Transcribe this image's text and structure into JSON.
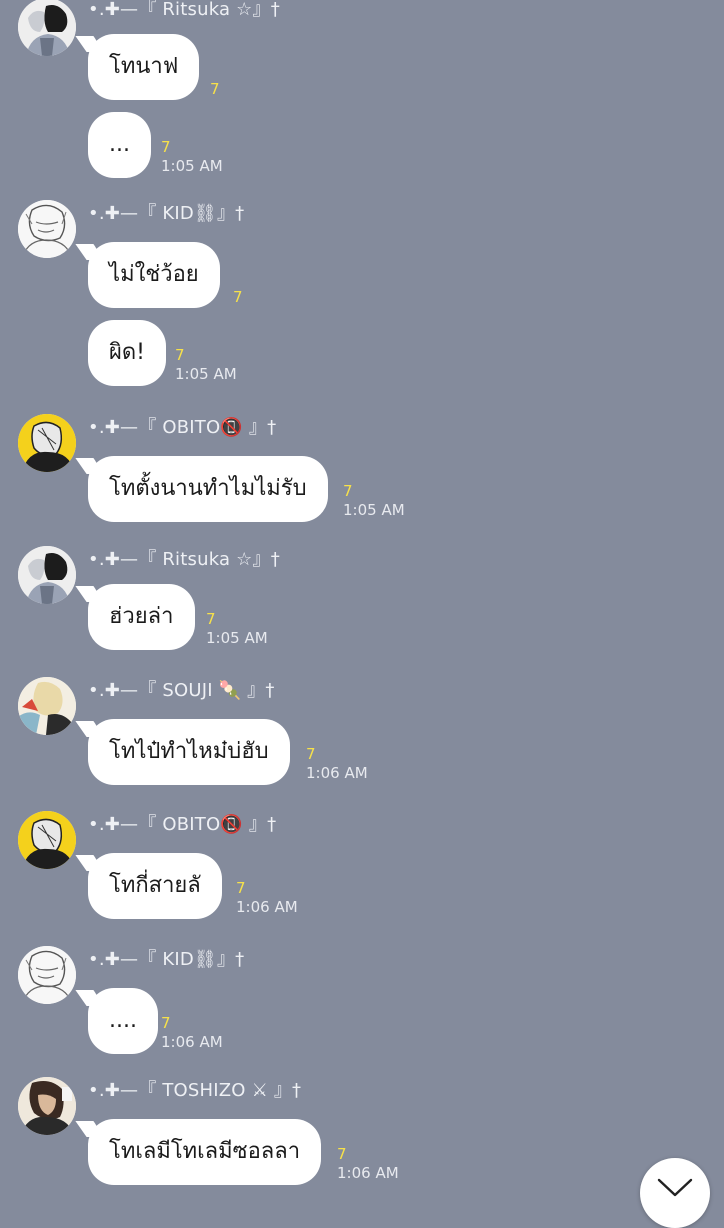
{
  "chat": {
    "messages": [
      {
        "sender": "•.✚—『 Ritsuka ☆』†",
        "avatar": "ritsuka-avatar",
        "bubbles": [
          {
            "text": "โทนาฟ",
            "read": "7",
            "time": ""
          },
          {
            "text": "...",
            "read": "7",
            "time": "1:05 AM"
          }
        ]
      },
      {
        "sender": "•.✚—『 KID⛓』†",
        "avatar": "kid-avatar",
        "bubbles": [
          {
            "text": "ไม่ใช่ว้อย",
            "read": "7",
            "time": ""
          },
          {
            "text": "ผิด!",
            "read": "7",
            "time": "1:05 AM"
          }
        ]
      },
      {
        "sender": "•.✚—『 OBITO📵 』†",
        "avatar": "obito-avatar",
        "bubbles": [
          {
            "text": "โทตั้งนานทำไมไม่รับ",
            "read": "7",
            "time": "1:05 AM"
          }
        ]
      },
      {
        "sender": "•.✚—『 Ritsuka ☆』†",
        "avatar": "ritsuka-avatar",
        "bubbles": [
          {
            "text": "ฮ่วยล่า",
            "read": "7",
            "time": "1:05 AM"
          }
        ]
      },
      {
        "sender": "•.✚—『 SOUJI 🍡 』†",
        "avatar": "souji-avatar",
        "bubbles": [
          {
            "text": "โทไป๋ทำไหม๋บ่ฮับ",
            "read": "7",
            "time": "1:06 AM"
          }
        ]
      },
      {
        "sender": "•.✚—『 OBITO📵 』†",
        "avatar": "obito-avatar",
        "bubbles": [
          {
            "text": "โทกี่สายลั",
            "read": "7",
            "time": "1:06 AM"
          }
        ]
      },
      {
        "sender": "•.✚—『 KID⛓』†",
        "avatar": "kid-avatar",
        "bubbles": [
          {
            "text": "....",
            "read": "7",
            "time": "1:06 AM"
          }
        ]
      },
      {
        "sender": "•.✚—『 TOSHIZO ⚔ 』†",
        "avatar": "toshizo-avatar",
        "bubbles": [
          {
            "text": "โทเลมีโทเลมีซอลลา",
            "read": "7",
            "time": "1:06 AM"
          }
        ]
      }
    ]
  },
  "scroll_button": {
    "icon": "chevron-down-icon"
  },
  "colors": {
    "background": "#848b9c",
    "bubble": "#ffffff",
    "read_count": "#f7e14a"
  }
}
